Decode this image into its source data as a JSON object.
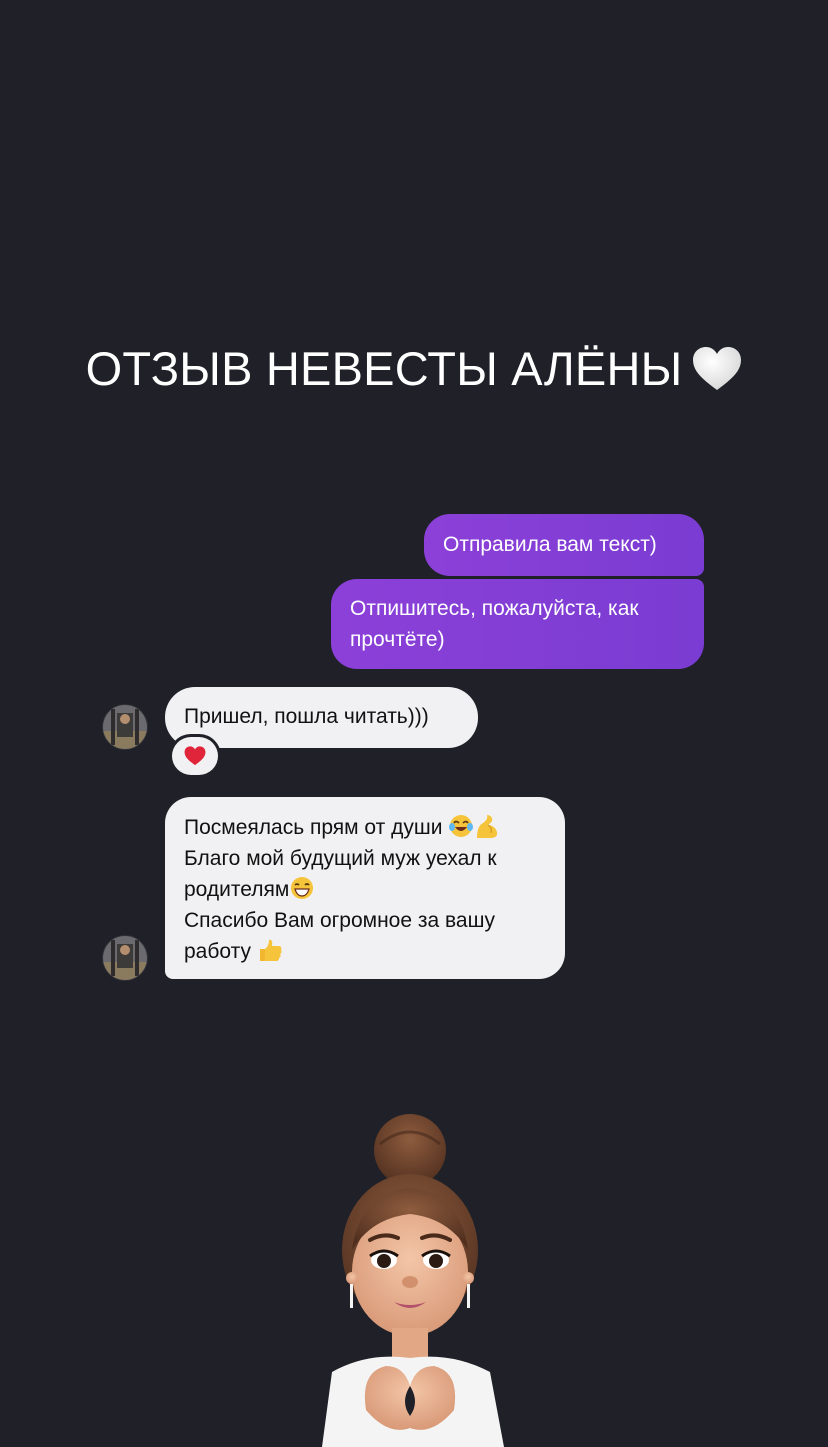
{
  "story": {
    "title": "ОТЗЫВ НЕВЕСТЫ АЛЁНЫ"
  },
  "messages": {
    "outgoing_1": "Отправила вам текст)",
    "outgoing_2_line1": "Отпишитесь, пожалуйста, как",
    "outgoing_2_line2": "прочтёте)",
    "incoming_1": "Пришел, пошла читать)))",
    "incoming_1_reaction": "heart-emoji",
    "incoming_2_line1": "Посмеялась прям от души",
    "incoming_2_line2": "Благо мой будущий муж уехал к",
    "incoming_2_line3": "родителям",
    "incoming_2_line4": "Спасибо Вам огромное за вашу",
    "incoming_2_line5": "работу"
  },
  "colors": {
    "background": "#1f2028",
    "outgoing_bubble": "#8c40d8",
    "incoming_bubble": "#f1f1f3",
    "title_text": "#ffffff"
  },
  "icons": {
    "title_heart": "white-heart-icon",
    "reaction": "red-heart-icon",
    "laugh": "tears-of-joy-emoji",
    "muscle": "flexed-biceps-emoji",
    "grin": "grinning-face-emoji",
    "thumb": "thumbs-up-emoji",
    "sticker": "memoji-heart-hands-sticker"
  }
}
